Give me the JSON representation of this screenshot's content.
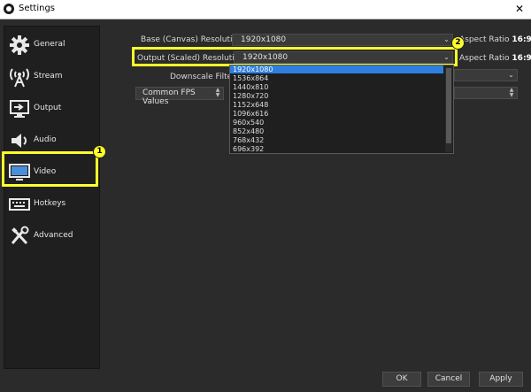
{
  "window": {
    "title": "Settings",
    "close_glyph": "✕"
  },
  "sidebar": {
    "items": [
      {
        "label": "General",
        "icon": "gear-icon"
      },
      {
        "label": "Stream",
        "icon": "broadcast-icon"
      },
      {
        "label": "Output",
        "icon": "output-icon"
      },
      {
        "label": "Audio",
        "icon": "speaker-icon"
      },
      {
        "label": "Video",
        "icon": "monitor-icon"
      },
      {
        "label": "Hotkeys",
        "icon": "keyboard-icon"
      },
      {
        "label": "Advanced",
        "icon": "wrench-screwdriver-icon"
      }
    ],
    "selected": "Video"
  },
  "annotations": {
    "badge_1": "1",
    "badge_2": "2",
    "color": "#ffff2b"
  },
  "video": {
    "base_label": "Base (Canvas) Resolution",
    "base_value": "1920x1080",
    "base_aspect_label": "Aspect Ratio",
    "base_aspect_value": "16:9",
    "output_label": "Output (Scaled) Resolution",
    "output_value": "1920x1080",
    "output_aspect_label": "Aspect Ratio",
    "output_aspect_value": "16:9",
    "downscale_label": "Downscale Filter",
    "fps_label": "Common FPS Values"
  },
  "dropdown": {
    "selected": "1920x1080",
    "options": [
      "1536x864",
      "1440x810",
      "1280x720",
      "1152x648",
      "1096x616",
      "960x540",
      "852x480",
      "768x432",
      "696x392"
    ]
  },
  "buttons": {
    "ok": "OK",
    "cancel": "Cancel",
    "apply": "Apply"
  },
  "colors": {
    "selection": "#2f7fe0",
    "highlight": "#ffff2b"
  }
}
